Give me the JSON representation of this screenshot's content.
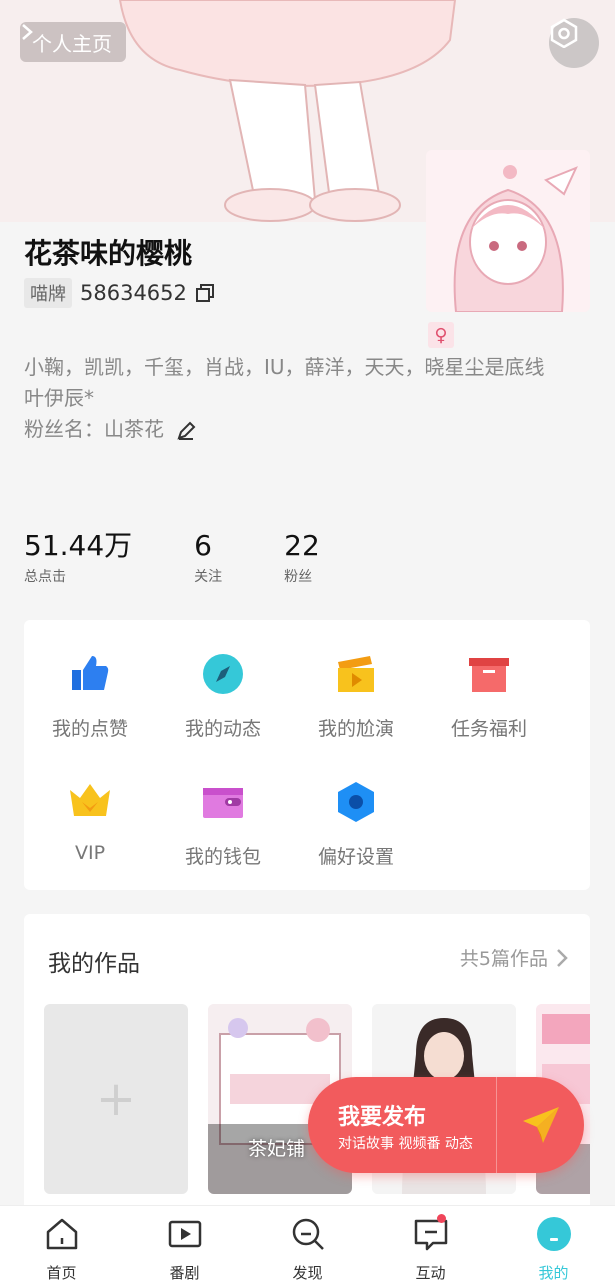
{
  "header": {
    "profile_link_label": "个人主页",
    "settings_icon": "settings-hex-icon"
  },
  "user": {
    "name": "花茶味的樱桃",
    "id_badge": "喵牌",
    "id_number": "58634652",
    "gender_symbol": "♀",
    "bio_line1": "小鞠，凯凯，千玺，肖战，IU，薛洋，天天，晓星尘是底线",
    "bio_line2": "叶伊辰*",
    "bio_line3": "粉丝名：山茶花"
  },
  "stats": [
    {
      "value": "51.44万",
      "label": "总点击"
    },
    {
      "value": "6",
      "label": "关注"
    },
    {
      "value": "22",
      "label": "粉丝"
    }
  ],
  "menu": [
    {
      "label": "我的点赞",
      "icon": "thumbs-up-icon",
      "color": "#2d7ff0"
    },
    {
      "label": "我的动态",
      "icon": "compass-icon",
      "color": "#35c8d8"
    },
    {
      "label": "我的尬演",
      "icon": "clapperboard-icon",
      "color": "#f5b021"
    },
    {
      "label": "任务福利",
      "icon": "gift-box-icon",
      "color": "#f05a5a"
    },
    {
      "label": "VIP",
      "icon": "crown-icon",
      "color": "#f8c21d"
    },
    {
      "label": "我的钱包",
      "icon": "wallet-icon",
      "color": "#d45ad8"
    },
    {
      "label": "偏好设置",
      "icon": "hex-gear-icon",
      "color": "#1e8ff5"
    }
  ],
  "works": {
    "title": "我的作品",
    "count": "共5篇作品",
    "add_symbol": "+",
    "item1_caption": "茶妃铺"
  },
  "publish": {
    "title": "我要发布",
    "subtitle": "对话故事 视频番 动态"
  },
  "nav": [
    {
      "label": "首页",
      "icon": "home-icon"
    },
    {
      "label": "番剧",
      "icon": "play-icon"
    },
    {
      "label": "发现",
      "icon": "discover-icon"
    },
    {
      "label": "互动",
      "icon": "message-icon",
      "has_dot": true
    },
    {
      "label": "我的",
      "icon": "mine-icon",
      "active": true
    }
  ],
  "colors": {
    "accent": "#35c8d8",
    "publish": "#f25b5d"
  }
}
